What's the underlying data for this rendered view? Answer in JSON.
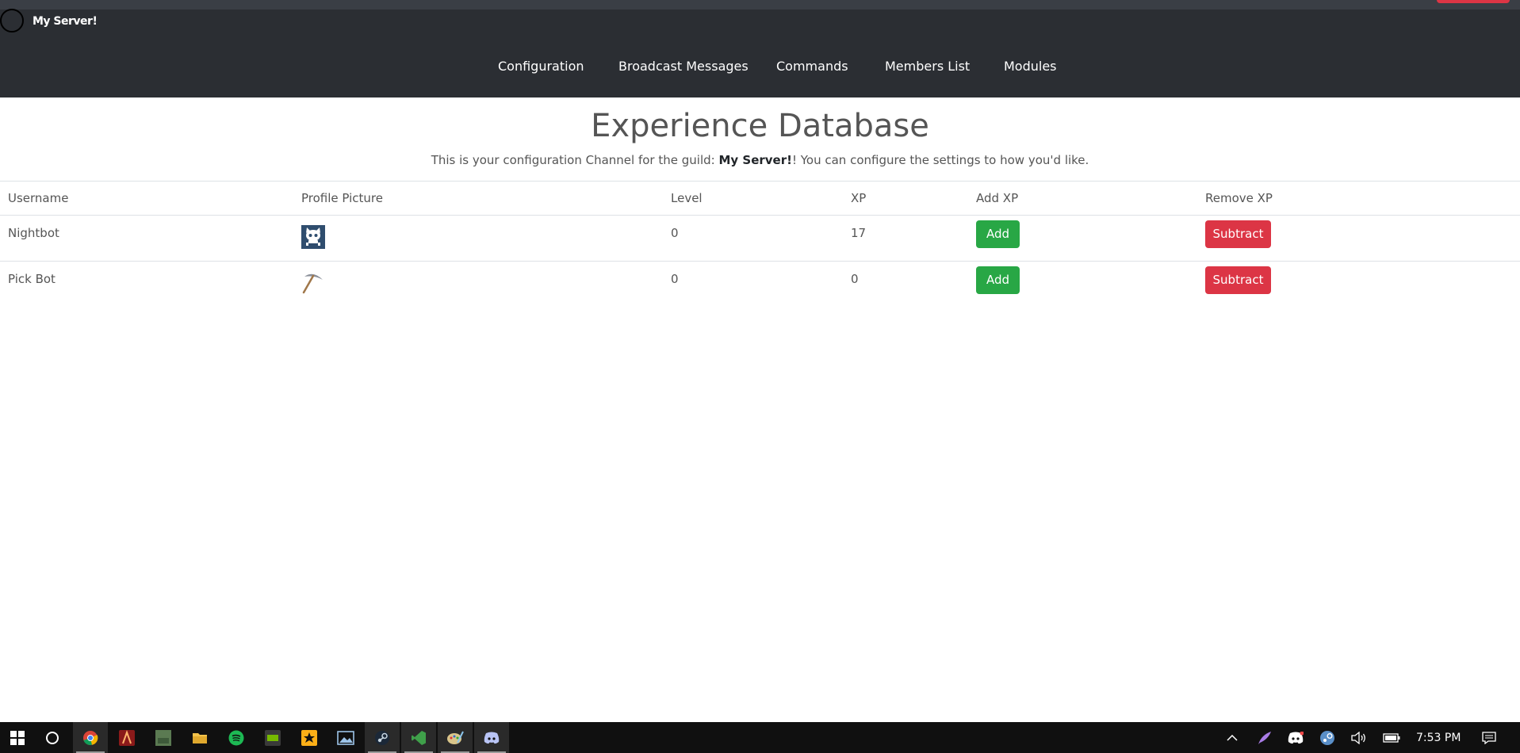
{
  "header": {
    "server_name": "My Server!",
    "nav": [
      "Configuration",
      "Broadcast Messages",
      "Commands",
      "Members List",
      "Modules"
    ]
  },
  "main": {
    "title": "Experience Database",
    "subtitle_prefix": "This is your configuration Channel for the guild: ",
    "guild_name": "My Server!",
    "subtitle_suffix": "! You can configure the settings to how you'd like."
  },
  "table": {
    "columns": [
      "Username",
      "Profile Picture",
      "Level",
      "XP",
      "Add XP",
      "Remove XP"
    ],
    "rows": [
      {
        "username": "Nightbot",
        "avatar": "nightbot-avatar-icon",
        "level": "0",
        "xp": "17",
        "add_label": "Add",
        "remove_label": "Subtract"
      },
      {
        "username": "Pick Bot",
        "avatar": "pickaxe-avatar-icon",
        "level": "0",
        "xp": "0",
        "add_label": "Add",
        "remove_label": "Subtract"
      }
    ]
  },
  "taskbar": {
    "clock": "7:53 PM",
    "apps": [
      "windows-start-icon",
      "cortana-icon",
      "chrome-icon",
      "app-a-icon",
      "photo-app-icon",
      "file-explorer-icon",
      "spotify-icon",
      "nvidia-icon",
      "rockstar-icon",
      "photos-icon",
      "steam-icon",
      "visual-studio-icon",
      "paint-icon",
      "discord-icon"
    ]
  },
  "colors": {
    "navbar": "#2b2e33",
    "add_button": "#28a745",
    "subtract_button": "#dc3545"
  }
}
